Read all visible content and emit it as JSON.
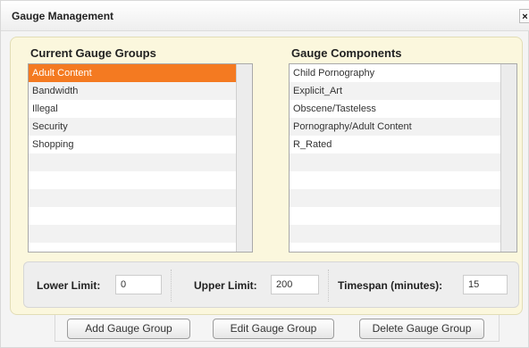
{
  "window": {
    "title": "Gauge Management",
    "close_label": "×"
  },
  "groups": {
    "heading": "Current Gauge Groups",
    "items": [
      "Adult Content",
      "Bandwidth",
      "Illegal",
      "Security",
      "Shopping"
    ],
    "selected": "Adult Content"
  },
  "components": {
    "heading": "Gauge Components",
    "items": [
      "Child Pornography",
      "Explicit_Art",
      "Obscene/Tasteless",
      "Pornography/Adult Content",
      "R_Rated"
    ]
  },
  "limits": {
    "lower_label": "Lower Limit:",
    "lower_value": "0",
    "upper_label": "Upper Limit:",
    "upper_value": "200",
    "timespan_label": "Timespan (minutes):",
    "timespan_value": "15"
  },
  "buttons": {
    "add": "Add Gauge Group",
    "edit": "Edit Gauge Group",
    "delete": "Delete Gauge Group"
  },
  "colors": {
    "selection": "#f47a21",
    "panel": "#fbf7dd"
  }
}
